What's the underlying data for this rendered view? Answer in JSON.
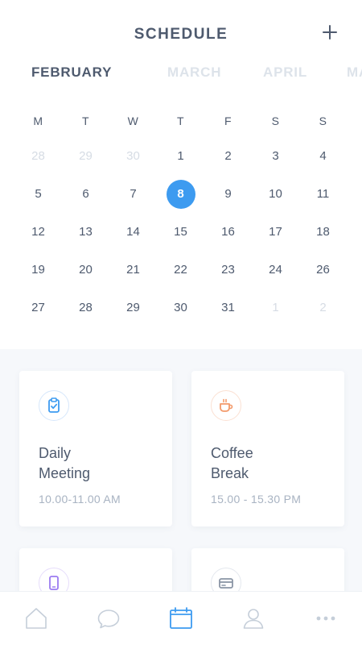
{
  "header": {
    "title": "SCHEDULE"
  },
  "months": [
    "FEBRUARY",
    "MARCH",
    "APRIL",
    "MA"
  ],
  "weekdays": [
    "M",
    "T",
    "W",
    "T",
    "F",
    "S",
    "S"
  ],
  "weeks": [
    [
      "28",
      "29",
      "30",
      "1",
      "2",
      "3",
      "4"
    ],
    [
      "5",
      "6",
      "7",
      "8",
      "9",
      "10",
      "11"
    ],
    [
      "12",
      "13",
      "14",
      "15",
      "16",
      "17",
      "18"
    ],
    [
      "19",
      "20",
      "21",
      "22",
      "23",
      "24",
      "26"
    ],
    [
      "27",
      "28",
      "29",
      "30",
      "31",
      "1",
      "2"
    ]
  ],
  "selected_day": "8",
  "events": [
    {
      "title": "Daily\nMeeting",
      "time": "10.00-11.00 AM",
      "icon": "clipboard-icon",
      "color": "#3d9bf0"
    },
    {
      "title": "Coffee\nBreak",
      "time": "15.00 - 15.30 PM",
      "icon": "coffee-icon",
      "color": "#f39a6b"
    },
    {
      "title": "",
      "time": "",
      "icon": "phone-icon",
      "color": "#9b7bf0"
    },
    {
      "title": "",
      "time": "",
      "icon": "card-icon",
      "color": "#8a95a5"
    }
  ],
  "tabs": [
    {
      "icon": "home-icon",
      "active": false
    },
    {
      "icon": "chat-icon",
      "active": false
    },
    {
      "icon": "calendar-icon",
      "active": true
    },
    {
      "icon": "user-icon",
      "active": false
    },
    {
      "icon": "more-icon",
      "active": false
    }
  ],
  "colors": {
    "accent": "#3d9bf0",
    "text": "#4e5a6e",
    "muted": "#d6dce4"
  }
}
